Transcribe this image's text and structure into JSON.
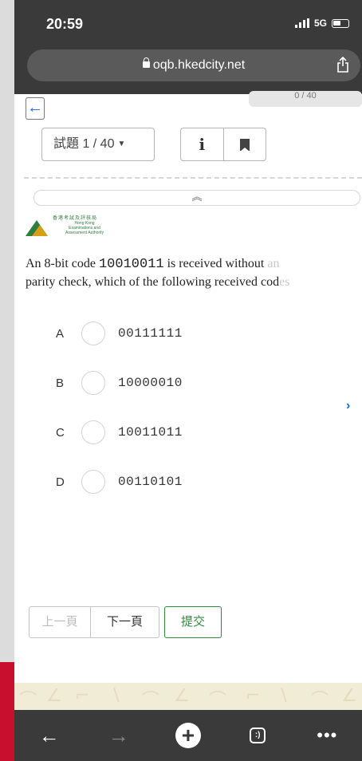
{
  "status_bar": {
    "time": "20:59",
    "network": "5G"
  },
  "browser": {
    "url": "oqb.hkedcity.net"
  },
  "quiz": {
    "progress": "0 / 40",
    "question_selector": "試題 1 / 40",
    "info_glyph": "i",
    "collapse_glyph": "︽",
    "logo": {
      "chinese": "香港考試及評核局",
      "english_line1": "Hong Kong",
      "english_line2": "Examinations and",
      "english_line3": "Assessment Authority"
    },
    "question": {
      "line1_start": "An 8-bit code ",
      "code": "10010011",
      "line1_end": " is received without ",
      "line1_faded": "an",
      "line2": "parity check, which of the following received cod",
      "line2_faded": "es"
    },
    "options": [
      {
        "letter": "A",
        "value": "00111111"
      },
      {
        "letter": "B",
        "value": "10000010"
      },
      {
        "letter": "C",
        "value": "10011011"
      },
      {
        "letter": "D",
        "value": "00110101"
      }
    ],
    "next_arrow": "›",
    "buttons": {
      "prev": "上一頁",
      "next": "下一頁",
      "submit": "提交"
    }
  },
  "toolbar": {
    "back": "←",
    "forward": "→",
    "new_tab": "+",
    "tabs": ":)",
    "more": "•••"
  },
  "colors": {
    "accent_blue": "#1a6bd6",
    "submit_green": "#2f8a3a",
    "chrome_dark": "#3a3a3a"
  }
}
